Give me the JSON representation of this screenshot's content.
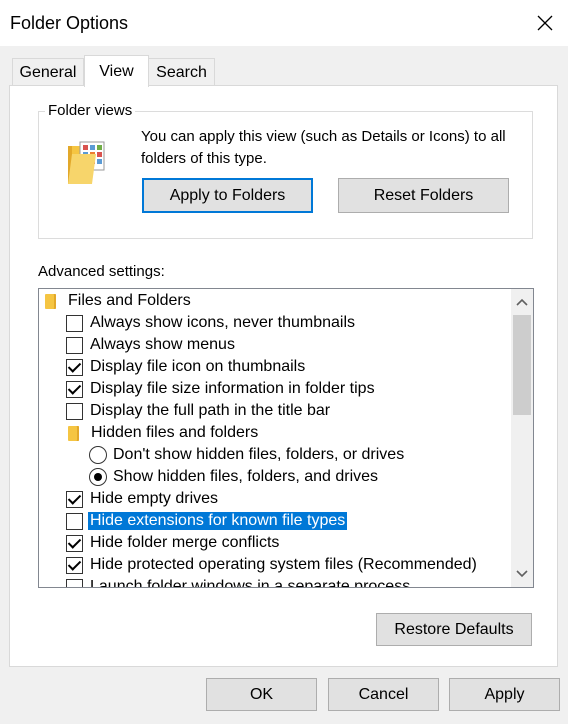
{
  "window": {
    "title": "Folder Options"
  },
  "tabs": [
    {
      "label": "General",
      "active": false
    },
    {
      "label": "View",
      "active": true
    },
    {
      "label": "Search",
      "active": false
    }
  ],
  "folder_views": {
    "label": "Folder views",
    "description": "You can apply this view (such as Details or Icons) to all folders of this type.",
    "apply_label": "Apply to Folders",
    "reset_label": "Reset Folders"
  },
  "advanced": {
    "label": "Advanced settings:",
    "items": [
      {
        "type": "folder",
        "label": "Files and Folders",
        "level": 0
      },
      {
        "type": "checkbox",
        "label": "Always show icons, never thumbnails",
        "checked": false,
        "level": 1
      },
      {
        "type": "checkbox",
        "label": "Always show menus",
        "checked": false,
        "level": 1
      },
      {
        "type": "checkbox",
        "label": "Display file icon on thumbnails",
        "checked": true,
        "level": 1
      },
      {
        "type": "checkbox",
        "label": "Display file size information in folder tips",
        "checked": true,
        "level": 1
      },
      {
        "type": "checkbox",
        "label": "Display the full path in the title bar",
        "checked": false,
        "level": 1
      },
      {
        "type": "folder",
        "label": "Hidden files and folders",
        "level": 1
      },
      {
        "type": "radio",
        "label": "Don't show hidden files, folders, or drives",
        "checked": false,
        "level": 2
      },
      {
        "type": "radio",
        "label": "Show hidden files, folders, and drives",
        "checked": true,
        "level": 2
      },
      {
        "type": "checkbox",
        "label": "Hide empty drives",
        "checked": true,
        "level": 1
      },
      {
        "type": "checkbox",
        "label": "Hide extensions for known file types",
        "checked": false,
        "level": 1,
        "selected": true
      },
      {
        "type": "checkbox",
        "label": "Hide folder merge conflicts",
        "checked": true,
        "level": 1
      },
      {
        "type": "checkbox",
        "label": "Hide protected operating system files (Recommended)",
        "checked": true,
        "level": 1
      },
      {
        "type": "checkbox",
        "label": "Launch folder windows in a separate process",
        "checked": false,
        "level": 1
      }
    ]
  },
  "restore_label": "Restore Defaults",
  "footer": {
    "ok_label": "OK",
    "cancel_label": "Cancel",
    "apply_label": "Apply"
  },
  "colors": {
    "selection": "#0078d7",
    "focus_border": "#0078d7"
  }
}
